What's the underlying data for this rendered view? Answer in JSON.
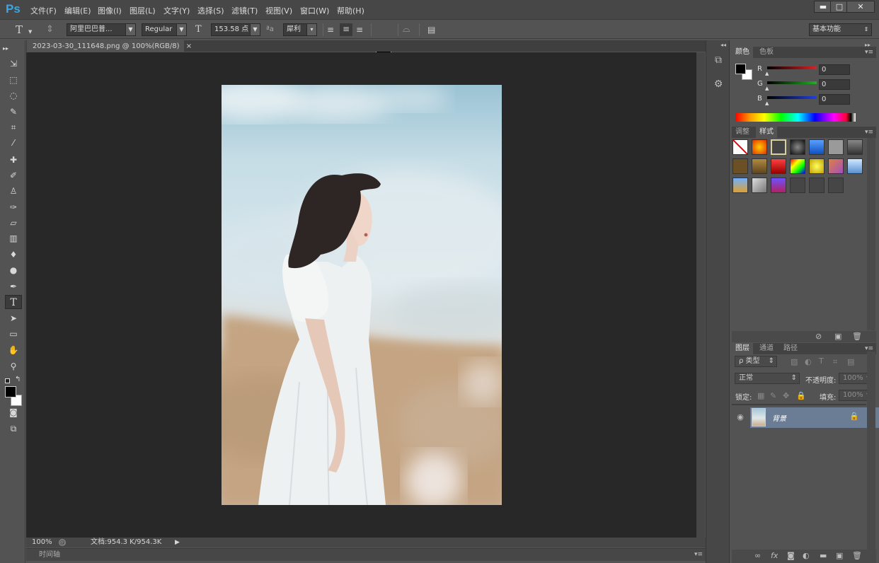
{
  "app": {
    "logo": "Ps"
  },
  "menu": [
    "文件(F)",
    "编辑(E)",
    "图像(I)",
    "图层(L)",
    "文字(Y)",
    "选择(S)",
    "滤镜(T)",
    "视图(V)",
    "窗口(W)",
    "帮助(H)"
  ],
  "window_controls": {
    "minimize": "▬",
    "maximize": "□",
    "close": "✕"
  },
  "options": {
    "font_family": "阿里巴巴普...",
    "font_style": "Regular",
    "font_size": "153.58 点",
    "antialias": "犀利",
    "text_color": "#000000",
    "workspace": "基本功能",
    "aa_icon": "ªa"
  },
  "document": {
    "tab_title": "2023-03-30_111648.png @ 100%(RGB/8)",
    "tab_close": "×",
    "zoom": "100%",
    "doc_size": "文档:954.3 K/954.3K",
    "timeline_label": "时间轴"
  },
  "color_panel": {
    "tabs": [
      "颜色",
      "色板"
    ],
    "channels": [
      {
        "label": "R",
        "value": "0",
        "color": "#e02020"
      },
      {
        "label": "G",
        "value": "0",
        "color": "#20b020"
      },
      {
        "label": "B",
        "value": "0",
        "color": "#2040e0"
      }
    ]
  },
  "styles_panel": {
    "tabs": [
      "调整",
      "样式"
    ],
    "active_tab": "样式"
  },
  "layers_panel": {
    "tabs": [
      "图层",
      "通道",
      "路径"
    ],
    "filter_label": "ρ 类型",
    "blend_mode": "正常",
    "opacity_label": "不透明度:",
    "opacity_value": "100%",
    "lock_label": "锁定:",
    "fill_label": "填充:",
    "fill_value": "100%",
    "layers": [
      {
        "name": "背景",
        "visible": true,
        "locked": true
      }
    ]
  },
  "footer_icons": [
    "link-icon",
    "fx-icon",
    "mask-icon",
    "adjustment-icon",
    "folder-icon",
    "new-layer-icon",
    "trash-icon"
  ],
  "texts": {
    "fx": "fx"
  }
}
